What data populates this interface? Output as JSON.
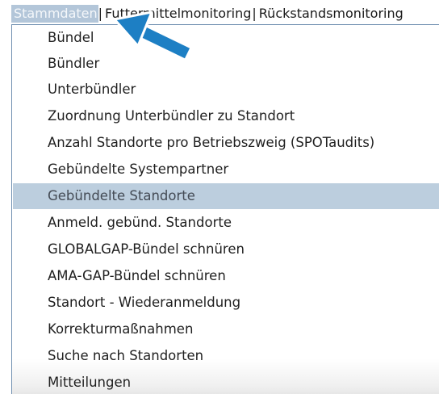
{
  "menubar": {
    "items": [
      {
        "label": "Stammdaten"
      },
      {
        "label": "Futtermittelmonitoring"
      },
      {
        "label": "Rückstandsmonitoring"
      }
    ],
    "separator": "|"
  },
  "dropdown": {
    "items": [
      {
        "label": "Bündel"
      },
      {
        "label": "Bündler"
      },
      {
        "label": "Unterbündler"
      },
      {
        "label": "Zuordnung Unterbündler zu Standort"
      },
      {
        "label": "Anzahl Standorte pro Betriebszweig (SPOTaudits)"
      },
      {
        "label": "Gebündelte Systempartner"
      },
      {
        "label": "Gebündelte Standorte"
      },
      {
        "label": "Anmeld. gebünd. Standorte"
      },
      {
        "label": "GLOBALGAP-Bündel schnüren"
      },
      {
        "label": "AMA-GAP-Bündel schnüren"
      },
      {
        "label": "Standort - Wiederanmeldung"
      },
      {
        "label": "Korrekturmaßnahmen"
      },
      {
        "label": "Suche nach Standorten"
      },
      {
        "label": "Mitteilungen"
      }
    ],
    "highlighted_index": 6
  },
  "colors": {
    "active_menu_bg": "#b3c6d9",
    "highlight_bg": "#bccede",
    "arrow": "#1d7fc4"
  },
  "annotation": {
    "icon": "pointer-arrow-icon"
  }
}
